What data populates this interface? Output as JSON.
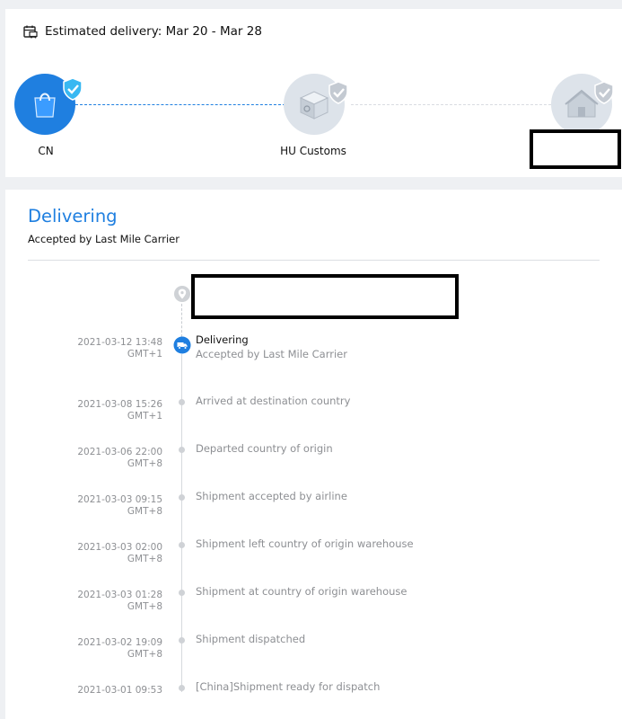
{
  "estimate": {
    "label": "Estimated delivery:",
    "range": "Mar 20 - Mar 28",
    "icon": "calendar-truck-icon"
  },
  "stages": [
    {
      "label": "CN",
      "icon": "shopping-bag-icon",
      "status": "completed"
    },
    {
      "label": "HU Customs",
      "icon": "customs-box-icon",
      "status": "pending"
    },
    {
      "label": "",
      "icon": "house-icon",
      "status": "pending"
    }
  ],
  "current": {
    "status": "Delivering",
    "detail": "Accepted by Last Mile Carrier"
  },
  "events": [
    {
      "date": "2021-03-12 13:48",
      "tz": "GMT+1",
      "title": "Delivering",
      "detail": "Accepted by Last Mile Carrier",
      "active": true
    },
    {
      "date": "2021-03-08 15:26",
      "tz": "GMT+1",
      "title": "Arrived at destination country"
    },
    {
      "date": "2021-03-06 22:00",
      "tz": "GMT+8",
      "title": "Departed country of origin"
    },
    {
      "date": "2021-03-03 09:15",
      "tz": "GMT+8",
      "title": "Shipment accepted by airline"
    },
    {
      "date": "2021-03-03 02:00",
      "tz": "GMT+8",
      "title": "Shipment left country of origin warehouse"
    },
    {
      "date": "2021-03-03 01:28",
      "tz": "GMT+8",
      "title": "Shipment at country of origin warehouse"
    },
    {
      "date": "2021-03-02 19:09",
      "tz": "GMT+8",
      "title": "Shipment dispatched"
    },
    {
      "date": "2021-03-01 09:53",
      "tz": "",
      "title": "[China]Shipment ready for dispatch"
    }
  ],
  "colors": {
    "accent": "#1f7fe0",
    "muted": "#8d8f93",
    "pending_circle": "#dde3ea"
  }
}
